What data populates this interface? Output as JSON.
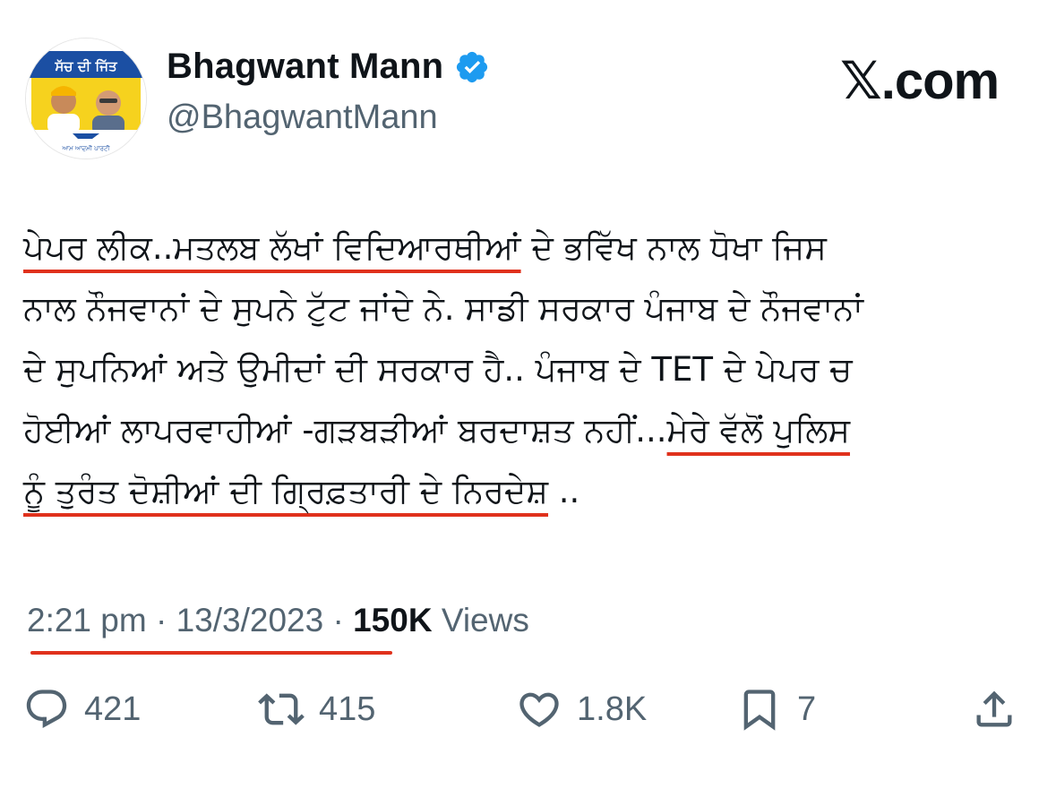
{
  "brand": {
    "label": "𝕏.com"
  },
  "author": {
    "name": "Bhagwant Mann",
    "handle": "@BhagwantMann",
    "verified": true,
    "avatar": {
      "banner_text": "ਸੱਚ ਦੀ ਜਿੱਤ",
      "footer_text": "ਆਮ ਆਦਮੀ ਪਾਰਟੀ"
    }
  },
  "tweet": {
    "line1": {
      "a": "ਪੇਪਰ ਲੀਕ..ਮਤਲਬ ਲੱਖਾਂ ਵਿਦਿਆਰਥੀਆਂ",
      "b": " ਦੇ ਭਵਿੱਖ ਨਾਲ ਧੋਖਾ ਜਿਸ"
    },
    "line2": "ਨਾਲ ਨੌਜਵਾਨਾਂ ਦੇ ਸੁਪਨੇ ਟੁੱਟ ਜਾਂਦੇ ਨੇ. ਸਾਡੀ ਸਰਕਾਰ ਪੰਜਾਬ ਦੇ ਨੌਜਵਾਨਾਂ",
    "line3": "ਦੇ ਸੁਪਨਿਆਂ ਅਤੇ ਉਮੀਦਾਂ ਦੀ ਸਰਕਾਰ ਹੈ.. ਪੰਜਾਬ ਦੇ TET ਦੇ ਪੇਪਰ ਚ",
    "line4": {
      "a": "ਹੋਈਆਂ ਲਾਪਰਵਾਹੀਆਂ -ਗੜਬੜੀਆਂ ਬਰਦਾਸ਼ਤ ਨਹੀਂ...",
      "b": "ਮੇਰੇ ਵੱਲੋਂ ਪੁਲਿਸ"
    },
    "line5": {
      "a": "ਨੂੰ ਤੁਰੰਤ ਦੋਸ਼ੀਆਂ ਦੀ ਗ੍ਰਿਫ਼ਤਾਰੀ ਦੇ ਨਿਰਦੇਸ਼",
      "b": " .."
    }
  },
  "meta": {
    "time": "2:21 pm",
    "sep1": " · ",
    "date": "13/3/2023",
    "sep2": " · ",
    "views_count": "150K",
    "views_label": " Views"
  },
  "actions": {
    "replies": "421",
    "reposts": "415",
    "likes": "1.8K",
    "bookmarks": "7"
  },
  "colors": {
    "text": "#0f1419",
    "secondary": "#536471",
    "verified": "#1d9bf0",
    "highlight": "#e0311c",
    "avatar_banner": "#1b4fa3",
    "avatar_yellow": "#f6d21e"
  }
}
